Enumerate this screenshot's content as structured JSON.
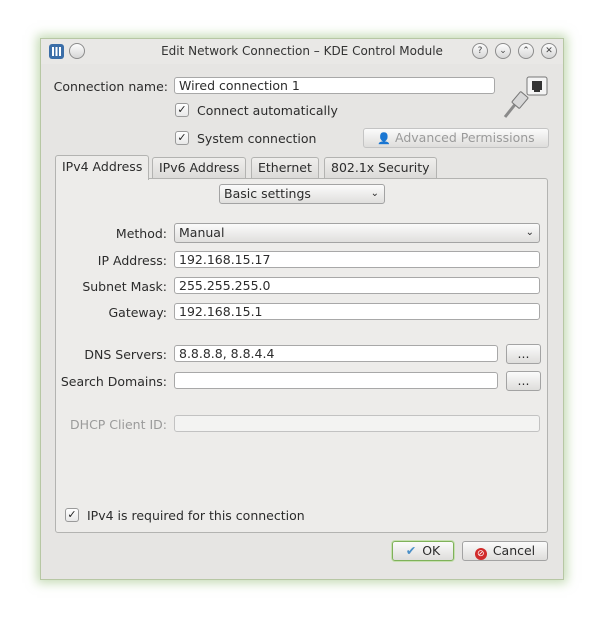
{
  "window": {
    "title": "Edit Network Connection – KDE Control Module",
    "buttons": [
      "?",
      "⌄",
      "⌃",
      "✕"
    ]
  },
  "connection": {
    "name_label": "Connection name:",
    "name_value": "Wired connection 1",
    "connect_auto_label": "Connect automatically",
    "connect_auto_checked": true,
    "system_conn_label": "System connection",
    "system_conn_checked": true,
    "advanced_permissions_label": "Advanced Permissions"
  },
  "tabs": [
    {
      "label": "IPv4 Address",
      "active": true
    },
    {
      "label": "IPv6 Address",
      "active": false
    },
    {
      "label": "Ethernet",
      "active": false
    },
    {
      "label": "802.1x Security",
      "active": false
    }
  ],
  "ipv4": {
    "settings_mode": "Basic settings",
    "method_label": "Method:",
    "method_value": "Manual",
    "ip_label": "IP Address:",
    "ip_value": "192.168.15.17",
    "mask_label": "Subnet Mask:",
    "mask_value": "255.255.255.0",
    "gateway_label": "Gateway:",
    "gateway_value": "192.168.15.1",
    "dns_label": "DNS Servers:",
    "dns_value": "8.8.8.8, 8.8.4.4",
    "search_label": "Search Domains:",
    "search_value": "",
    "ellipsis": "...",
    "dhcp_label": "DHCP Client ID:",
    "dhcp_value": "",
    "required_label": "IPv4 is required for this connection",
    "required_checked": true
  },
  "footer": {
    "ok_label": "OK",
    "cancel_label": "Cancel"
  }
}
